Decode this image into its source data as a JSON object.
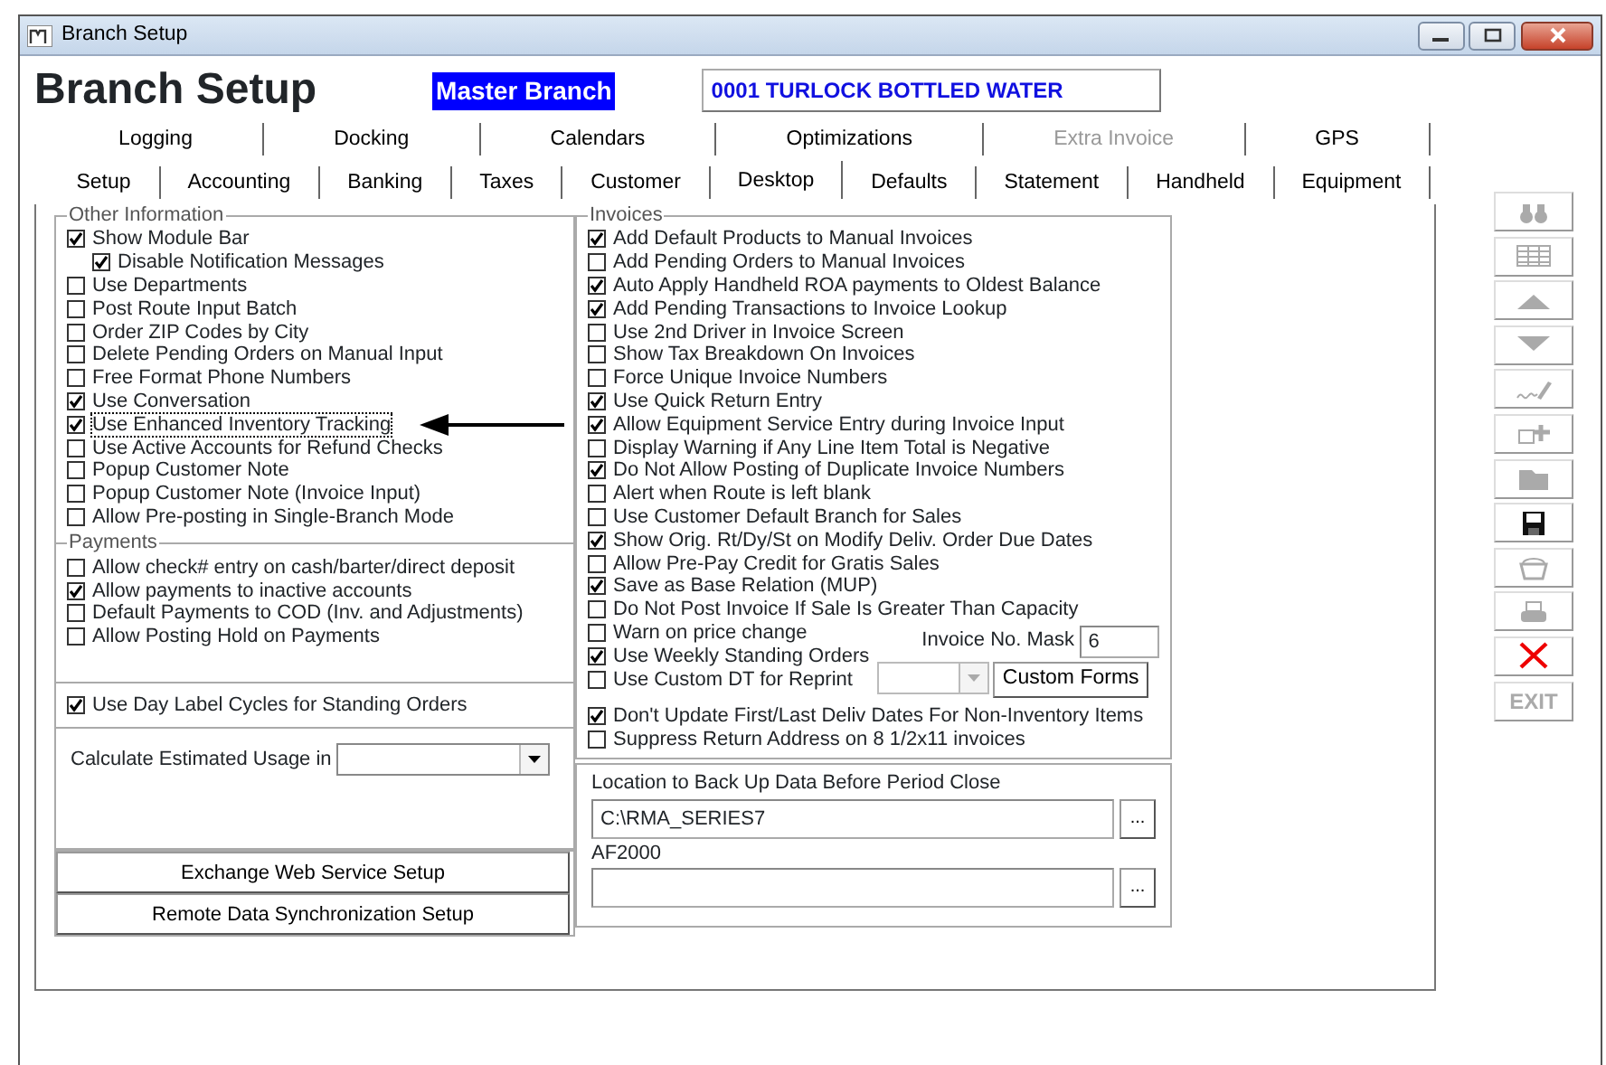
{
  "window": {
    "title": "Branch Setup"
  },
  "header": {
    "title": "Branch Setup",
    "branch_label": "Master Branch",
    "branch_value": "0001  TURLOCK BOTTLED WATER"
  },
  "tab_rows": [
    [
      {
        "label": "Logging",
        "selected": false,
        "disabled": false
      },
      {
        "label": "Docking",
        "selected": false,
        "disabled": false
      },
      {
        "label": "Calendars",
        "selected": false,
        "disabled": false
      },
      {
        "label": "Optimizations",
        "selected": false,
        "disabled": false
      },
      {
        "label": "Extra Invoice",
        "selected": false,
        "disabled": true
      },
      {
        "label": "GPS",
        "selected": false,
        "disabled": false
      }
    ],
    [
      {
        "label": "Setup",
        "selected": false,
        "disabled": false
      },
      {
        "label": "Accounting",
        "selected": false,
        "disabled": false
      },
      {
        "label": "Banking",
        "selected": false,
        "disabled": false
      },
      {
        "label": "Taxes",
        "selected": false,
        "disabled": false
      },
      {
        "label": "Customer",
        "selected": false,
        "disabled": false
      },
      {
        "label": "Desktop",
        "selected": true,
        "disabled": false
      },
      {
        "label": "Defaults",
        "selected": false,
        "disabled": false
      },
      {
        "label": "Statement",
        "selected": false,
        "disabled": false
      },
      {
        "label": "Handheld",
        "selected": false,
        "disabled": false
      },
      {
        "label": "Equipment",
        "selected": false,
        "disabled": false
      }
    ]
  ],
  "other_information": {
    "title": "Other Information",
    "options": [
      {
        "label": "Show Module Bar",
        "checked": true,
        "focused": false,
        "children": [
          {
            "label": "Disable Notification Messages",
            "checked": true,
            "focused": false
          }
        ]
      },
      {
        "label": "Use Departments",
        "checked": false,
        "focused": false
      },
      {
        "label": "Post Route Input Batch",
        "checked": false,
        "focused": false
      },
      {
        "label": "Order ZIP Codes by City",
        "checked": false,
        "focused": false
      },
      {
        "label": "Delete Pending Orders on Manual Input",
        "checked": false,
        "focused": false
      },
      {
        "label": "Free Format Phone Numbers",
        "checked": false,
        "focused": false
      },
      {
        "label": "Use Conversation",
        "checked": true,
        "focused": false
      },
      {
        "label": "Use Enhanced Inventory Tracking",
        "checked": true,
        "focused": true
      },
      {
        "label": "Use Active Accounts for Refund Checks",
        "checked": false,
        "focused": false
      },
      {
        "label": "Popup Customer Note",
        "checked": false,
        "focused": false
      },
      {
        "label": "Popup Customer Note (Invoice Input)",
        "checked": false,
        "focused": false
      },
      {
        "label": "Allow Pre-posting in Single-Branch Mode",
        "checked": false,
        "focused": false
      }
    ]
  },
  "payments": {
    "title": "Payments",
    "options": [
      {
        "label": "Allow check# entry on cash/barter/direct deposit",
        "checked": false
      },
      {
        "label": "Allow payments to inactive accounts",
        "checked": true
      },
      {
        "label": "Default Payments to COD (Inv. and Adjustments)",
        "checked": false
      },
      {
        "label": "Allow Posting Hold on Payments",
        "checked": false
      }
    ]
  },
  "day_label_option": {
    "label": "Use Day Label Cycles for Standing Orders",
    "checked": true
  },
  "usage": {
    "label": "Calculate Estimated Usage in"
  },
  "setup_buttons": [
    "Exchange Web Service Setup",
    "Remote Data Synchronization Setup"
  ],
  "invoices": {
    "title": "Invoices",
    "options": [
      {
        "label": "Add Default Products to Manual Invoices",
        "checked": true
      },
      {
        "label": "Add Pending Orders to Manual Invoices",
        "checked": false
      },
      {
        "label": "Auto Apply Handheld ROA payments to Oldest Balance",
        "checked": true
      },
      {
        "label": "Add Pending Transactions to Invoice Lookup",
        "checked": true
      },
      {
        "label": "Use 2nd Driver in Invoice Screen",
        "checked": false
      },
      {
        "label": "Show Tax Breakdown On Invoices",
        "checked": false
      },
      {
        "label": "Force Unique Invoice Numbers",
        "checked": false
      },
      {
        "label": "Use Quick Return Entry",
        "checked": true
      },
      {
        "label": "Allow Equipment  Service Entry during Invoice Input",
        "checked": true
      },
      {
        "label": "Display Warning if Any Line Item Total is Negative",
        "checked": false
      },
      {
        "label": "Do Not Allow Posting of Duplicate Invoice Numbers",
        "checked": true
      },
      {
        "label": "Alert when Route is left blank",
        "checked": false
      },
      {
        "label": "Use Customer Default Branch for Sales",
        "checked": false
      },
      {
        "label": "Show Orig. Rt/Dy/St on Modify Deliv. Order Due Dates",
        "checked": true
      },
      {
        "label": "Allow Pre-Pay Credit for Gratis Sales",
        "checked": false
      },
      {
        "label": "Save as Base Relation (MUP)",
        "checked": true
      },
      {
        "label": "Do Not Post Invoice If Sale Is Greater Than Capacity",
        "checked": false
      }
    ],
    "middle_options": [
      {
        "label": "Warn on price change",
        "checked": false
      },
      {
        "label": "Use Weekly Standing Orders",
        "checked": true
      },
      {
        "label": "Use Custom DT for Reprint",
        "checked": false
      }
    ],
    "invoice_mask": {
      "label": "Invoice No. Mask",
      "value": "6"
    },
    "reprint_dropdown": {
      "disabled": true
    },
    "custom_forms_button": "Custom Forms",
    "final_options": [
      {
        "label": "Don't Update First/Last Deliv Dates For Non-Inventory Items",
        "checked": true
      },
      {
        "label": "Suppress Return Address on 8 1/2x11 invoices",
        "checked": false
      }
    ]
  },
  "backup": {
    "label": "Location to Back Up Data Before Period Close",
    "value": "C:\\RMA_SERIES7",
    "browse": "..."
  },
  "af2000": {
    "label": "AF2000",
    "browse": "..."
  },
  "toolbar": [
    {
      "kind": "find",
      "disabled": true
    },
    {
      "kind": "grid",
      "disabled": true
    },
    {
      "kind": "up",
      "disabled": true
    },
    {
      "kind": "down",
      "disabled": true
    },
    {
      "kind": "sign",
      "disabled": true
    },
    {
      "kind": "add",
      "disabled": true
    },
    {
      "kind": "folder",
      "disabled": true
    },
    {
      "kind": "save",
      "disabled": false
    },
    {
      "kind": "basket",
      "disabled": true
    },
    {
      "kind": "print",
      "disabled": true
    },
    {
      "kind": "delete",
      "disabled": false
    },
    {
      "kind": "exit",
      "label": "EXIT",
      "disabled": true
    }
  ]
}
